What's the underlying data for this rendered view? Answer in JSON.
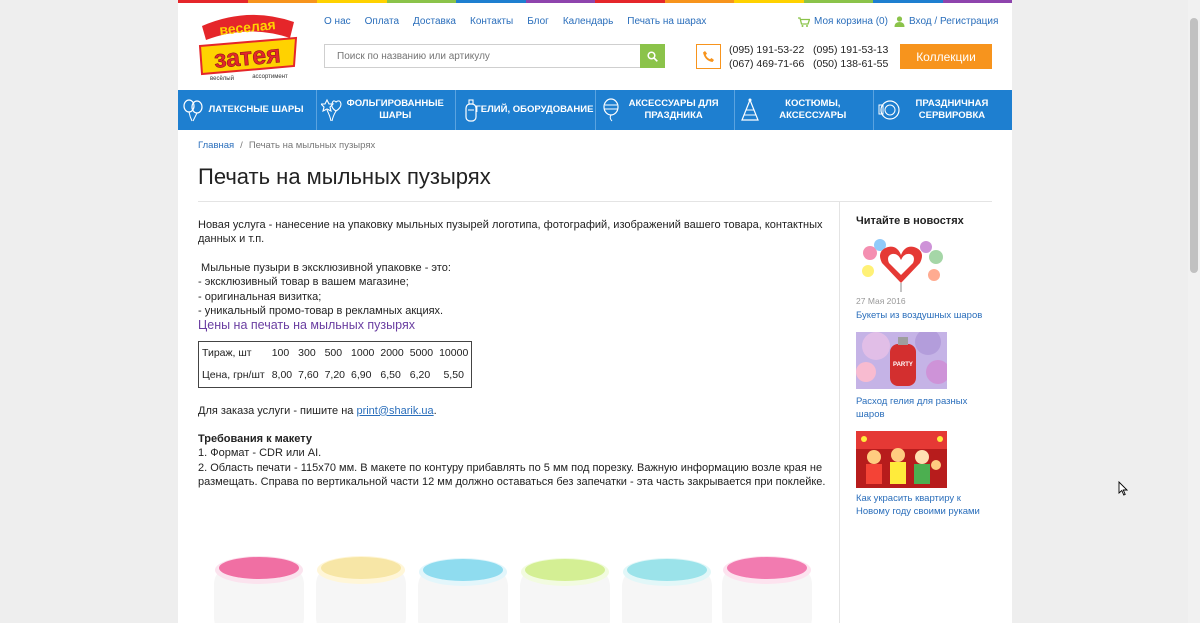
{
  "brand": {
    "logo_text_top": "веселая",
    "logo_text_main": "затея",
    "logo_text_left": "весёлый",
    "logo_text_right": "ассортимент",
    "colors": {
      "accent_blue": "#1e7fd0",
      "orange": "#f7941d",
      "green": "#8bc34a",
      "yellow": "#ffd200",
      "red": "#e5262a"
    }
  },
  "topnav": [
    "О нас",
    "Оплата",
    "Доставка",
    "Контакты",
    "Блог",
    "Календарь",
    "Печать на шарах"
  ],
  "cart": {
    "label": "Моя корзина (0)",
    "icon": "cart-icon"
  },
  "login": {
    "label": "Вход / Регистрация",
    "icon": "user-icon"
  },
  "search": {
    "placeholder": "Поиск по названию или артикулу",
    "icon": "search-icon"
  },
  "phones": [
    "(095) 191-53-22",
    "(095) 191-53-13",
    "(067) 469-71-66",
    "(050) 138-61-55"
  ],
  "collections_button": "Коллекции",
  "categories": [
    {
      "label": "Латексные шары",
      "icon": "balloons-icon"
    },
    {
      "label": "Фольгированные шары",
      "icon": "foil-balloons-icon"
    },
    {
      "label": "Гелий, оборудование",
      "icon": "helium-tank-icon"
    },
    {
      "label": "Аксессуары для праздника",
      "icon": "accessories-icon"
    },
    {
      "label": "Костюмы, аксессуары",
      "icon": "party-hat-icon"
    },
    {
      "label": "Праздничная сервировка",
      "icon": "plate-icon"
    }
  ],
  "breadcrumb": {
    "home": "Главная",
    "separator": "/",
    "current": "Печать на мыльных пузырях"
  },
  "page_title": "Печать на мыльных пузырях",
  "content": {
    "intro": "Новая услуга - нанесение на упаковку мыльных пузырей логотипа, фотографий, изображений вашего товара, контактных данных и т.п.",
    "list_heading": " Мыльные пузыри в эксклюзивной упаковке - это:",
    "list": [
      "- эксклюзивный товар в вашем магазине;",
      "- оригинальная визитка;",
      "- уникальный промо-товар в рекламных акциях."
    ],
    "prices_title": "Цены на печать на мыльных пузырях",
    "prices_table": {
      "row1_label": "Тираж, шт",
      "row1": [
        "100",
        "300",
        "500",
        "1000",
        "2000",
        "5000",
        "10000"
      ],
      "row2_label": "Цена, грн/шт",
      "row2": [
        "8,00",
        "7,60",
        "7,20",
        "6,90",
        "6,50",
        "6,20",
        "5,50"
      ]
    },
    "order_text": "Для заказа услуги - пишите на ",
    "order_email": "print@sharik.ua",
    "order_end": ".",
    "requirements_title": "Требования к макету",
    "requirements": [
      "1. Формат - CDR или AI.",
      "2. Область печати - 115х70 мм. В макете по контуру прибавлять по 5 мм под порезку. Важную информацию возле края не размещать. Справа по вертикальной части 12 мм должно оставаться без запечатки - эта часть закрывается при поклейке."
    ]
  },
  "sidebar": {
    "title": "Читайте в новостях",
    "news": [
      {
        "date": "27 Мая 2016",
        "title": "Букеты из воздушных шаров"
      },
      {
        "date": "",
        "title": "Расход гелия для разных шаров"
      },
      {
        "date": "",
        "title": "Как украсить квартиру к Новому году своими руками"
      }
    ]
  }
}
